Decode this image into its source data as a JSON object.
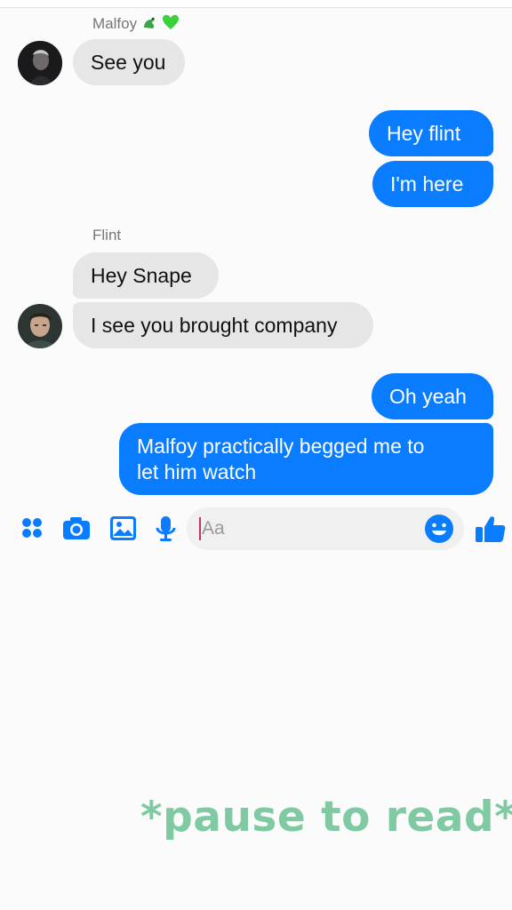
{
  "conversation": {
    "groups": [
      {
        "sender": "Malfoy",
        "messages": [
          {
            "text": "See you"
          }
        ]
      },
      {
        "sender": "",
        "messages": [
          {
            "text": "Hey flint"
          },
          {
            "text": "I'm here"
          }
        ]
      },
      {
        "sender": "Flint",
        "messages": [
          {
            "text": "Hey Snape"
          },
          {
            "text": "I see you brought company"
          }
        ]
      },
      {
        "sender": "",
        "messages": [
          {
            "text": "Oh yeah"
          },
          {
            "text": "Malfoy practically begged me to\nlet him watch"
          }
        ]
      }
    ]
  },
  "composer": {
    "placeholder": "Aa",
    "icons": [
      "apps-icon",
      "camera-icon",
      "gallery-icon",
      "microphone-icon",
      "emoji-icon",
      "thumbs-up-icon"
    ]
  },
  "overlay": {
    "text": "*pause to read*"
  },
  "colors": {
    "outgoing_bubble": "#0a7cff",
    "incoming_bubble": "#e6e6e6",
    "accent_icons": "#0a7cff",
    "overlay_text": "#7fcaa3"
  }
}
